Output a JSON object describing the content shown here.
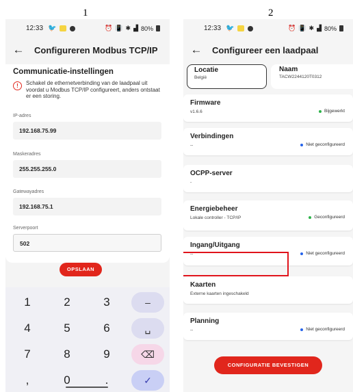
{
  "labels": {
    "panel1": "1",
    "panel2": "2"
  },
  "statusbar": {
    "time": "12:33",
    "battery": "80%"
  },
  "screen1": {
    "title": "Configureren Modbus TCP/IP",
    "section_title": "Communicatie-instellingen",
    "warning": "Schakel de ethernetverbinding van de laadpaal uit voordat u Modbus TCP/IP configureert, anders ontstaat er een storing.",
    "fields": [
      {
        "label": "IP-adres",
        "value": "192.168.75.99"
      },
      {
        "label": "Maskeradres",
        "value": "255.255.255.0"
      },
      {
        "label": "Gatewayadres",
        "value": "192.168.75.1"
      },
      {
        "label": "Serverpoort",
        "value": "502"
      }
    ],
    "save_label": "OPSLAAN",
    "keys": [
      "1",
      "2",
      "3",
      "–",
      "4",
      "5",
      "6",
      "␣",
      "7",
      "8",
      "9",
      "⌫",
      ",",
      "0",
      ".",
      "✓"
    ]
  },
  "screen2": {
    "title": "Configureer een laadpaal",
    "location": {
      "title": "Locatie",
      "value": "België"
    },
    "name": {
      "title": "Naam",
      "value": "TACW2244120T0312"
    },
    "cards": [
      {
        "title": "Firmware",
        "sub": "v1.6.6",
        "status": "Bijgewerkt",
        "status_color": "#2db34a"
      },
      {
        "title": "Verbindingen",
        "sub": "--",
        "status": "Niet geconfigureerd",
        "status_color": "#2563eb"
      },
      {
        "title": "OCPP-server",
        "sub": "-",
        "status": "",
        "status_color": ""
      },
      {
        "title": "Energiebeheer",
        "sub": "Lokale controller - TCP/IP",
        "status": "Geconfigureerd",
        "status_color": "#2db34a"
      },
      {
        "title": "Ingang/Uitgang",
        "sub": "--",
        "status": "Niet geconfigureerd",
        "status_color": "#2563eb"
      },
      {
        "title": "Kaarten",
        "sub": "Externe kaarten ingeschakeld",
        "status": "",
        "status_color": ""
      },
      {
        "title": "Planning",
        "sub": "--",
        "status": "Niet geconfigureerd",
        "status_color": "#2563eb"
      }
    ],
    "confirm_label": "CONFIGURATIE BEVESTIGEN"
  }
}
